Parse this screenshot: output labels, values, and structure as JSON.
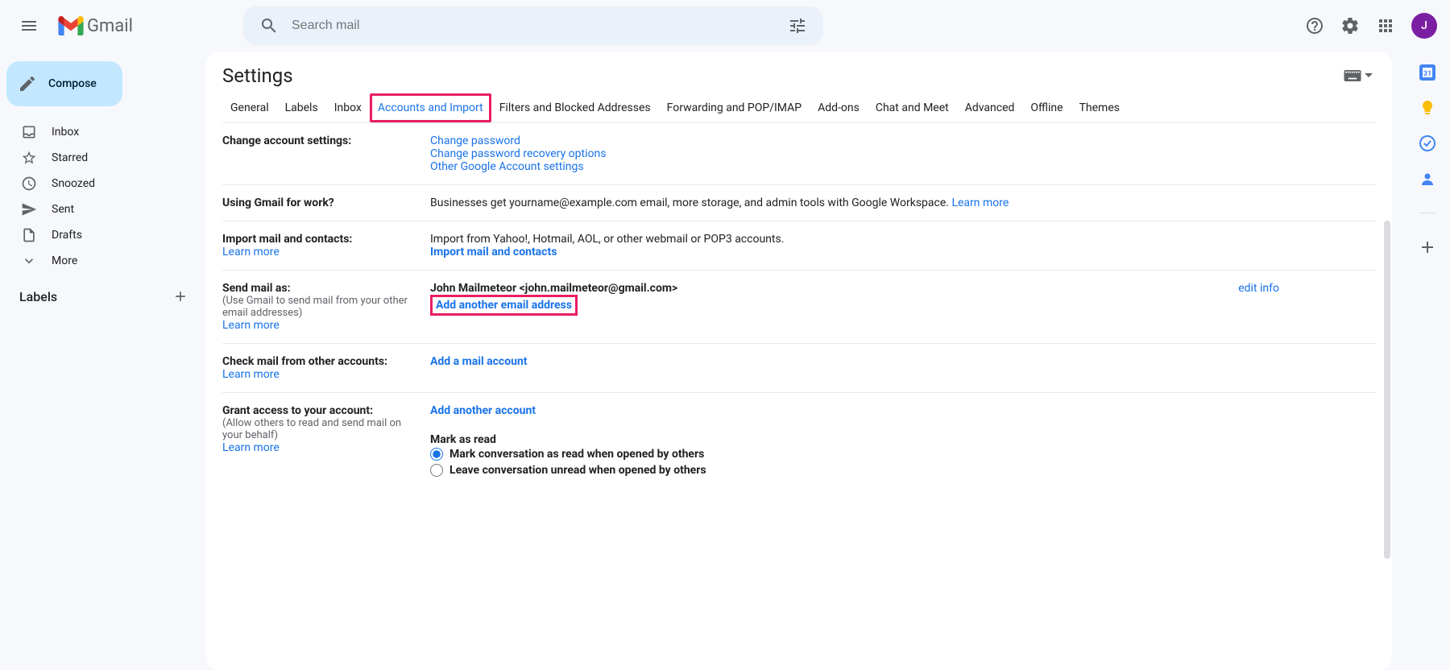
{
  "header": {
    "logo_text": "Gmail",
    "search_placeholder": "Search mail",
    "avatar_letter": "J"
  },
  "sidebar": {
    "compose": "Compose",
    "items": [
      {
        "label": "Inbox"
      },
      {
        "label": "Starred"
      },
      {
        "label": "Snoozed"
      },
      {
        "label": "Sent"
      },
      {
        "label": "Drafts"
      },
      {
        "label": "More"
      }
    ],
    "labels_heading": "Labels"
  },
  "settings": {
    "title": "Settings",
    "tabs": [
      "General",
      "Labels",
      "Inbox",
      "Accounts and Import",
      "Filters and Blocked Addresses",
      "Forwarding and POP/IMAP",
      "Add-ons",
      "Chat and Meet",
      "Advanced",
      "Offline",
      "Themes"
    ],
    "active_tab": "Accounts and Import",
    "sections": {
      "change_account": {
        "label": "Change account settings:",
        "links": [
          "Change password",
          "Change password recovery options",
          "Other Google Account settings"
        ]
      },
      "work": {
        "label": "Using Gmail for work?",
        "text": "Businesses get yourname@example.com email, more storage, and admin tools with Google Workspace. ",
        "learn": "Learn more"
      },
      "import": {
        "label": "Import mail and contacts:",
        "learn": "Learn more",
        "text": "Import from Yahoo!, Hotmail, AOL, or other webmail or POP3 accounts.",
        "action": "Import mail and contacts"
      },
      "send_as": {
        "label": "Send mail as:",
        "sub": "(Use Gmail to send mail from your other email addresses)",
        "learn": "Learn more",
        "identity": "John Mailmeteor <john.mailmeteor@gmail.com>",
        "edit": "edit info",
        "add": "Add another email address"
      },
      "check_mail": {
        "label": "Check mail from other accounts:",
        "learn": "Learn more",
        "add": "Add a mail account"
      },
      "grant": {
        "label": "Grant access to your account:",
        "sub": "(Allow others to read and send mail on your behalf)",
        "learn": "Learn more",
        "add": "Add another account",
        "mark_heading": "Mark as read",
        "radio1": "Mark conversation as read when opened by others",
        "radio2": "Leave conversation unread when opened by others"
      }
    }
  }
}
